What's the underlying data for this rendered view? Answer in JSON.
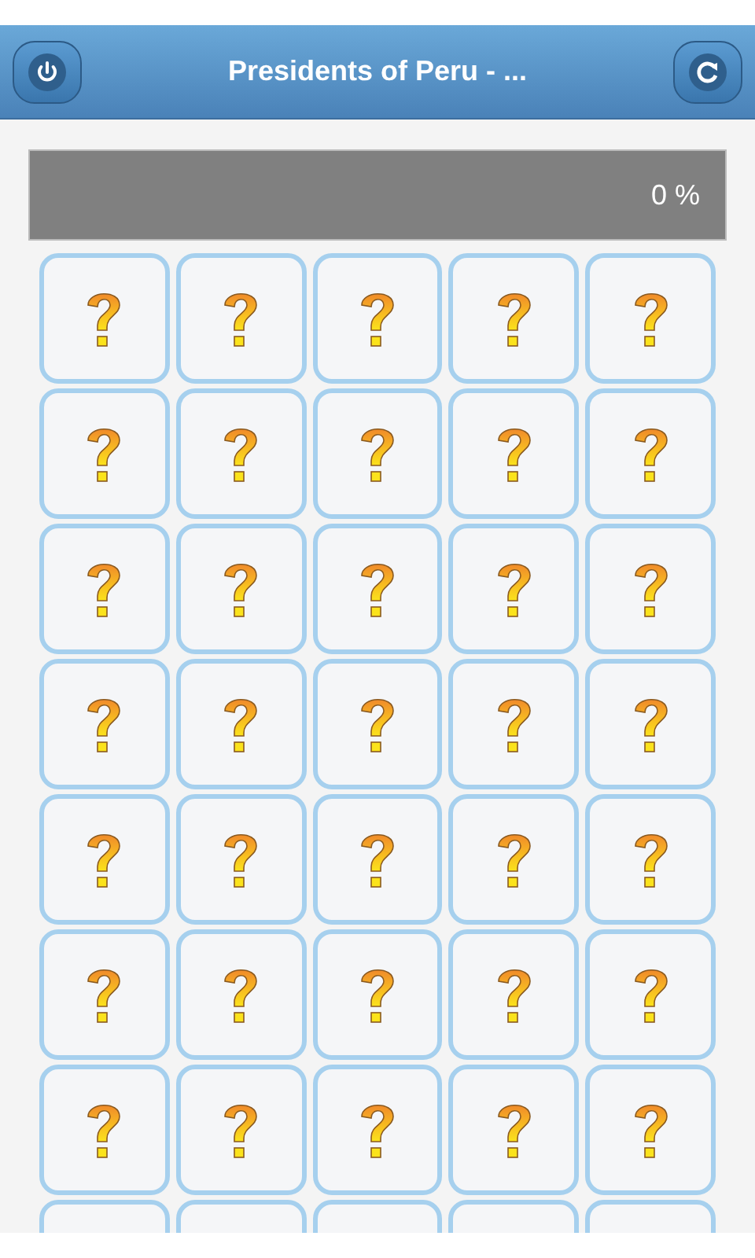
{
  "header": {
    "title": "Presidents of Peru - ..."
  },
  "progress": {
    "level": 0,
    "reading": "0 %"
  },
  "cards": [
    {
      "revealed": false
    },
    {
      "revealed": false
    },
    {
      "revealed": false
    },
    {
      "revealed": false
    },
    {
      "revealed": false
    },
    {
      "revealed": false
    },
    {
      "revealed": false
    },
    {
      "revealed": false
    },
    {
      "revealed": false
    },
    {
      "revealed": false
    },
    {
      "revealed": false
    },
    {
      "revealed": false
    },
    {
      "revealed": false
    },
    {
      "revealed": false
    },
    {
      "revealed": false
    },
    {
      "revealed": false
    },
    {
      "revealed": false
    },
    {
      "revealed": false
    },
    {
      "revealed": false
    },
    {
      "revealed": false
    },
    {
      "revealed": false
    },
    {
      "revealed": false
    },
    {
      "revealed": false
    },
    {
      "revealed": false
    },
    {
      "revealed": false
    },
    {
      "revealed": false
    },
    {
      "revealed": false
    },
    {
      "revealed": false
    },
    {
      "revealed": false
    },
    {
      "revealed": false
    },
    {
      "revealed": false
    },
    {
      "revealed": false
    },
    {
      "revealed": false
    },
    {
      "revealed": false
    },
    {
      "revealed": false
    }
  ],
  "cards_cut_off": [
    {
      "revealed": false
    },
    {
      "revealed": false
    },
    {
      "revealed": false
    },
    {
      "revealed": false
    },
    {
      "revealed": false
    }
  ]
}
